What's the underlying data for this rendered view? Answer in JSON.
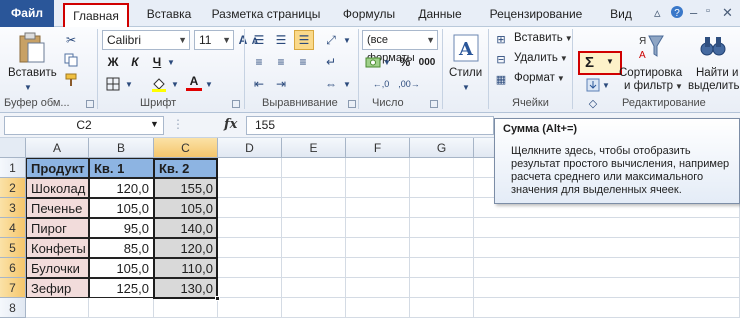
{
  "tabs": {
    "file": "Файл",
    "home": "Главная",
    "insert": "Вставка",
    "layout": "Разметка страницы",
    "formulas": "Формулы",
    "data": "Данные",
    "review": "Рецензирование",
    "view": "Вид"
  },
  "ribbon": {
    "clipboard": {
      "paste": "Вставить",
      "label": "Буфер обм..."
    },
    "font": {
      "name": "Calibri",
      "size": "11",
      "bold": "Ж",
      "italic": "К",
      "underline": "Ч",
      "grow": "A",
      "shrink": "A",
      "font_color": "A",
      "label": "Шрифт"
    },
    "alignment": {
      "label": "Выравнивание"
    },
    "number": {
      "format": "(все форматы",
      "currency": "%",
      "percent": "%",
      "thousands": "000",
      "label": "Число"
    },
    "styles": {
      "label": "Стили"
    },
    "cells": {
      "insert": "Вставить",
      "delete": "Удалить",
      "format": "Формат",
      "label": "Ячейки"
    },
    "editing": {
      "sum": "Σ",
      "sort_line1": "Сортировка",
      "sort_line2": "и фильтр",
      "find_line1": "Найти и",
      "find_line2": "выделить",
      "label": "Редактирование"
    }
  },
  "formula_bar": {
    "name_box": "C2",
    "fx": "fx",
    "value": "155"
  },
  "columns": [
    "A",
    "B",
    "C",
    "D",
    "E",
    "F",
    "G"
  ],
  "rows": [
    "1",
    "2",
    "3",
    "4",
    "5",
    "6",
    "7",
    "8"
  ],
  "table": {
    "headers": [
      "Продукт",
      "Кв. 1",
      "Кв. 2"
    ],
    "data": [
      [
        "Шоколад",
        "120,0",
        "155,0"
      ],
      [
        "Печенье",
        "105,0",
        "105,0"
      ],
      [
        "Пирог",
        "95,0",
        "140,0"
      ],
      [
        "Конфеты",
        "85,0",
        "120,0"
      ],
      [
        "Булочки",
        "105,0",
        "110,0"
      ],
      [
        "Зефир",
        "125,0",
        "130,0"
      ]
    ]
  },
  "tooltip": {
    "title": "Сумма (Alt+=)",
    "lines": [
      "Щелкните здесь, чтобы отобразить",
      "результат простого вычисления, например",
      "расчета среднего или максимального",
      "значения для выделенных ячеек."
    ]
  },
  "colors": {
    "header_fill": "#8db4e2",
    "product_fill": "#f2dcdb",
    "q2_fill": "#d9d9d9",
    "highlight_border": "#d00000",
    "file_tab": "#2a5699"
  }
}
